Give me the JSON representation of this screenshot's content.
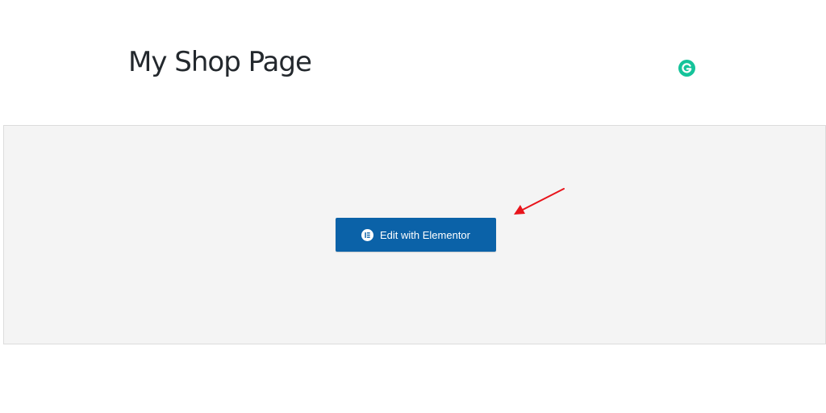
{
  "page": {
    "title": "My Shop Page"
  },
  "editor": {
    "button_label": "Edit with Elementor"
  },
  "colors": {
    "button_bg": "#0b62a8",
    "grammarly_green": "#15c39a",
    "annotation_arrow": "#e8141b",
    "editor_bg": "#f4f4f4"
  },
  "icons": {
    "grammarly": "grammarly-icon",
    "elementor": "elementor-icon",
    "annotation": "arrow-icon"
  }
}
